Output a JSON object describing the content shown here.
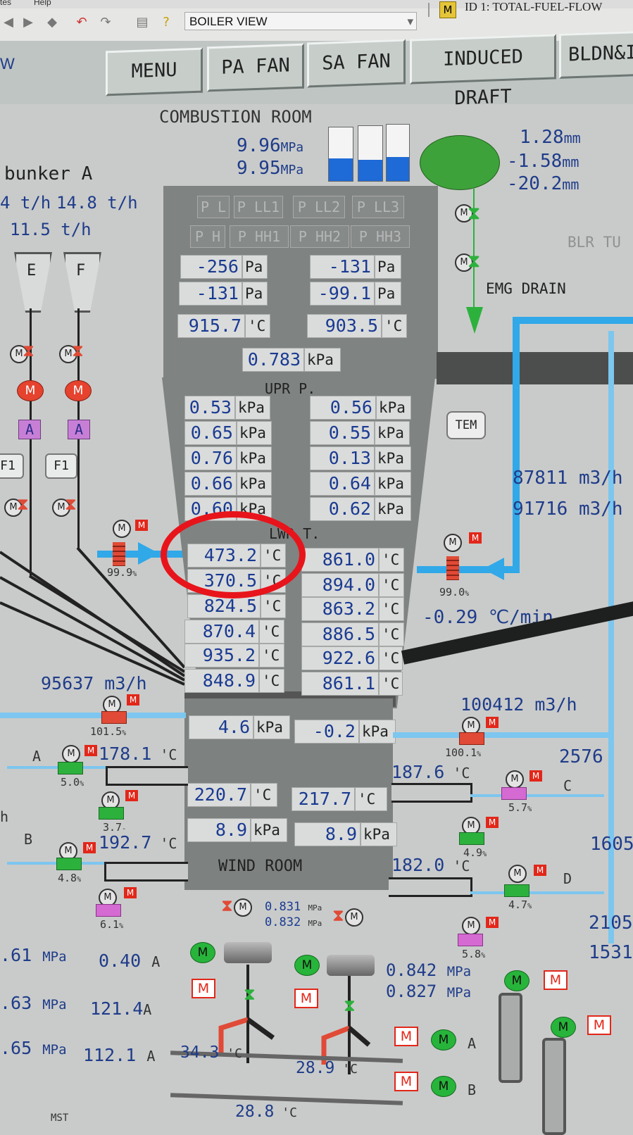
{
  "menubar": {
    "items": [
      "tes",
      "Help"
    ]
  },
  "toolbar": {
    "view_select": "BOILER VIEW",
    "id_label": "ID 1: TOTAL-FUEL-FLOW"
  },
  "nav": {
    "menu": "MENU",
    "pa_fan": "PA FAN",
    "sa_fan": "SA FAN",
    "induced_draft": "INDUCED DRAFT",
    "bldn": "BLDN&I"
  },
  "header": {
    "w_label": "W",
    "combustion_room": "COMBUSTION ROOM",
    "p1": "9.96",
    "p2": "9.95",
    "mpa": "MPa",
    "mm": "mm",
    "level1": "1.28",
    "level2": "-1.58",
    "level3": "-20.2",
    "blr_tu": "BLR TU",
    "emg_drain": "EMG DRAIN",
    "tem": "TEM"
  },
  "left": {
    "bunker": "bunker A",
    "flow1": "4 t/h",
    "flow2": "14.8 t/h",
    "flow3": "11.5 t/h",
    "mill_e": "E",
    "mill_f": "F",
    "a1": "A",
    "a2": "A",
    "f1a": "F1",
    "f1b": "F1",
    "damper_pct": "99.9",
    "air_flow": "95637 m3/h",
    "sa_damper": "101.5",
    "branch_a": "A",
    "branch_b": "B",
    "temp_a": "178.1",
    "temp_b": "192.7",
    "deg_c": "'C",
    "dampA1": "5.0",
    "dampA2": "3.7",
    "dampB1": "4.8",
    "dampB2": "6.1",
    "h_label": "h",
    "mpa_vals": [
      ".61",
      ".63",
      ".65"
    ],
    "mpa_unit": "MPa",
    "amps": [
      "0.40",
      "121.4",
      "112.1"
    ],
    "amp_unit": "A"
  },
  "furnace": {
    "sigs_row1": [
      "P L",
      "P LL1",
      "P LL2",
      "P LL3"
    ],
    "sigs_row2": [
      "P H",
      "P HH1",
      "P HH2",
      "P HH3"
    ],
    "pres_left": [
      "-256",
      "-131"
    ],
    "pres_right": [
      "-131",
      "-99.1"
    ],
    "pa": "Pa",
    "temp_left": "915.7",
    "temp_right": "903.5",
    "degc": "'C",
    "kpa_top": "0.783",
    "kpa": "kPa",
    "upr_label": "UPR P.",
    "upr_left": [
      "0.53",
      "0.65",
      "0.76",
      "0.66",
      "0.60"
    ],
    "upr_right": [
      "0.56",
      "0.55",
      "0.13",
      "0.64",
      "0.62"
    ],
    "lwr_label": "LWR T.",
    "lwr_left": [
      "473.2",
      "370.5",
      "824.5",
      "870.4",
      "935.2",
      "848.9"
    ],
    "lwr_right": [
      "861.0",
      "894.0",
      "863.2",
      "886.5",
      "922.6",
      "861.1"
    ],
    "wind_p_left": "4.6",
    "wind_p_right": "-0.2",
    "wind_t_left": "220.7",
    "wind_t_right": "217.7",
    "wind_p2_left": "8.9",
    "wind_p2_right": "8.9",
    "wind_room": "WIND ROOM"
  },
  "right": {
    "flow1": "87811",
    "flow2": "91716",
    "m3h": "m3/h",
    "damper_pct": "99.0",
    "rate": "-0.29",
    "rate_unit": "℃/min",
    "air_flow": "100412 m3/h",
    "sa_damper": "100.1",
    "v2576": "2576",
    "temp_c": "187.6",
    "temp_d": "182.0",
    "branch_c": "C",
    "branch_d": "D",
    "dampC1": "5.7",
    "dampC2": "4.9",
    "dampD1": "4.7",
    "dampD2": "5.8",
    "v1605": "1605",
    "v2105": "2105",
    "v1531": "1531",
    "mpa1": "0.842",
    "mpa2": "0.827",
    "mpa_unit": "MPa",
    "row_a": "A",
    "row_b": "B"
  },
  "bottom": {
    "mpa1": "0.831",
    "mpa2": "0.832",
    "mpa_unit": "MPa",
    "t1": "34.3",
    "t2": "28.9",
    "t3": "28.8",
    "degc": "'C",
    "mst": "MST"
  },
  "colors": {
    "accent_blue": "#31a8e8",
    "value_blue": "#1a3a92",
    "alarm_red": "#e8141b",
    "running_green": "#27b43a"
  }
}
